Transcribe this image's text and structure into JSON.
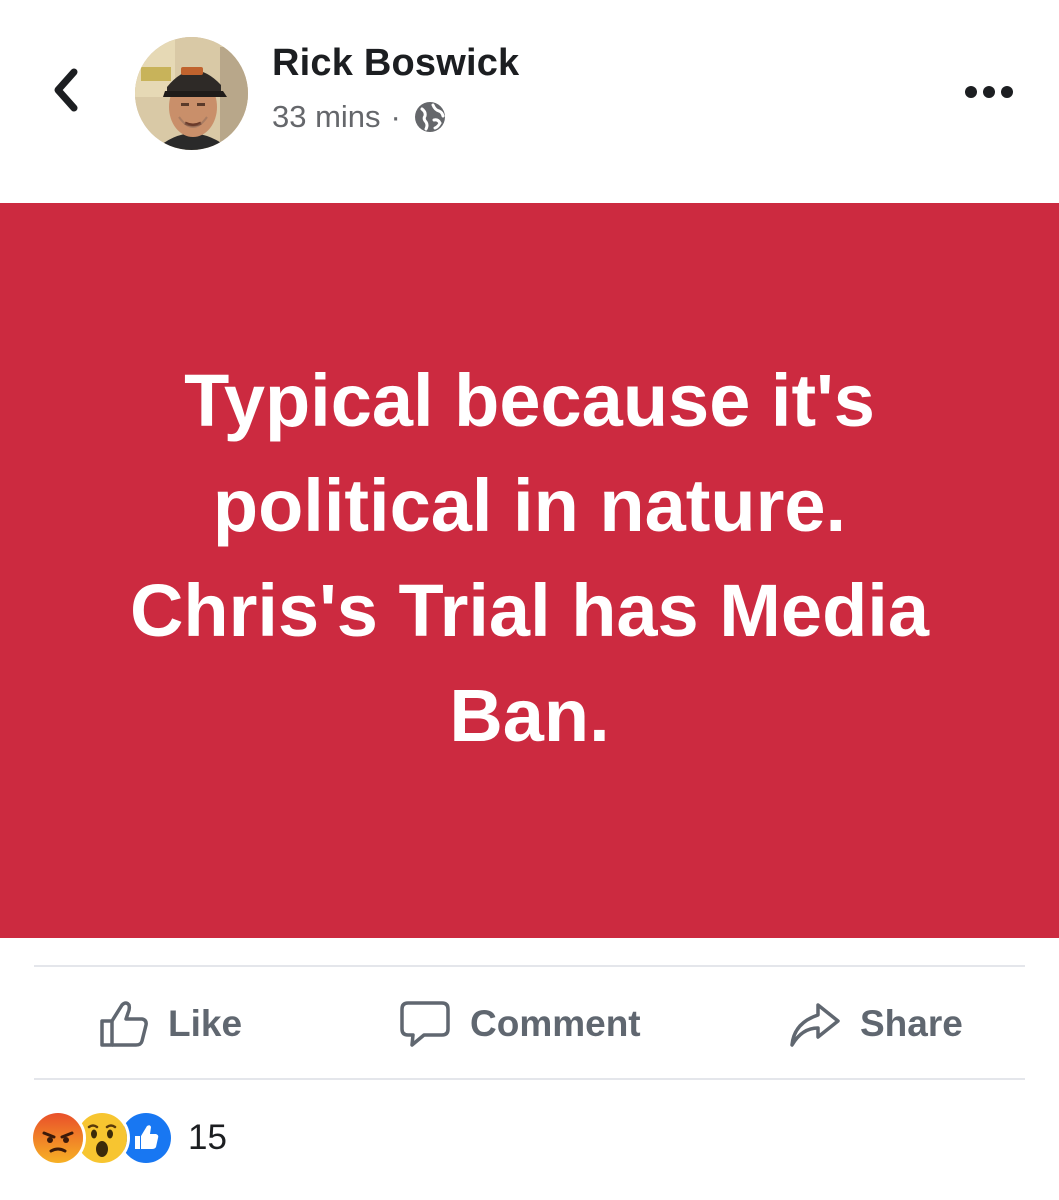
{
  "header": {
    "author_name": "Rick Boswick",
    "timestamp": "33 mins",
    "separator": "·",
    "privacy_icon": "globe-icon",
    "more_icon": "more-dots-icon",
    "back_icon": "chevron-left-icon"
  },
  "post": {
    "text": "Typical because it's political in nature. Chris's Trial has Media Ban.",
    "background_color": "#cc2a40",
    "text_color": "#ffffff"
  },
  "actions": {
    "like_label": "Like",
    "comment_label": "Comment",
    "share_label": "Share"
  },
  "reactions": {
    "icons": [
      "angry-reaction-icon",
      "wow-reaction-icon",
      "like-reaction-icon"
    ],
    "count": "15"
  }
}
